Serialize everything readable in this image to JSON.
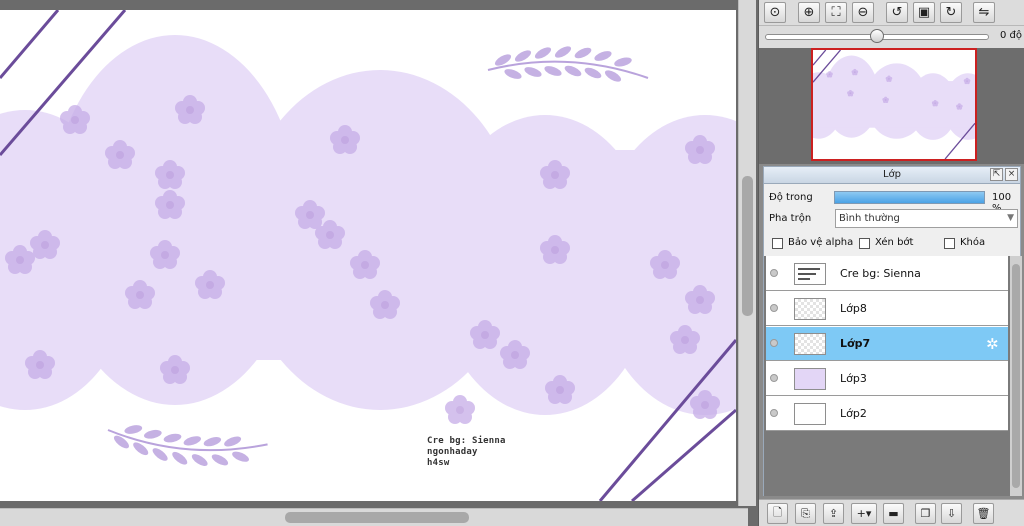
{
  "canvas": {
    "watermark_lines": [
      "Cre bg: Sienna",
      "ngonhaday",
      "h4sw"
    ],
    "colors": {
      "cloud": "#e8ddf8",
      "flower": "#c8b0e8",
      "leaf": "#c4b2e0",
      "stripe": "#6b4c9a",
      "background": "#ffffff"
    }
  },
  "navigator": {
    "toolbar_icons": [
      "zoom-actual-icon",
      "zoom-in-icon",
      "fit-window-icon",
      "zoom-out-icon",
      "rotate-left-icon",
      "fit-screen-icon",
      "rotate-right-icon",
      "flip-icon"
    ],
    "rotation_value": "0 độ",
    "rotation_fraction": 0.5
  },
  "layer_panel": {
    "title": "Lớp",
    "opacity_label": "Độ trong",
    "opacity_value": "100 %",
    "opacity_fraction": 1.0,
    "blend_label": "Pha trộn",
    "blend_value": "Bình thường",
    "checkboxes": {
      "alpha": "Bảo vệ alpha",
      "clip": "Xén bớt",
      "lock": "Khóa"
    },
    "layers": [
      {
        "name": "Cre bg: Sienna",
        "thumb": "text",
        "selected": false
      },
      {
        "name": "Lớp8",
        "thumb": "transparent",
        "selected": false
      },
      {
        "name": "Lớp7",
        "thumb": "transparent",
        "selected": true
      },
      {
        "name": "Lớp3",
        "thumb": "purple",
        "selected": false
      },
      {
        "name": "Lớp2",
        "thumb": "white",
        "selected": false
      }
    ],
    "toolbar_icons": [
      "new-layer-icon",
      "copy-layer-icon",
      "import-layer-icon",
      "add-menu-icon",
      "folder-icon",
      "duplicate-icon",
      "merge-icon",
      "delete-icon"
    ]
  }
}
